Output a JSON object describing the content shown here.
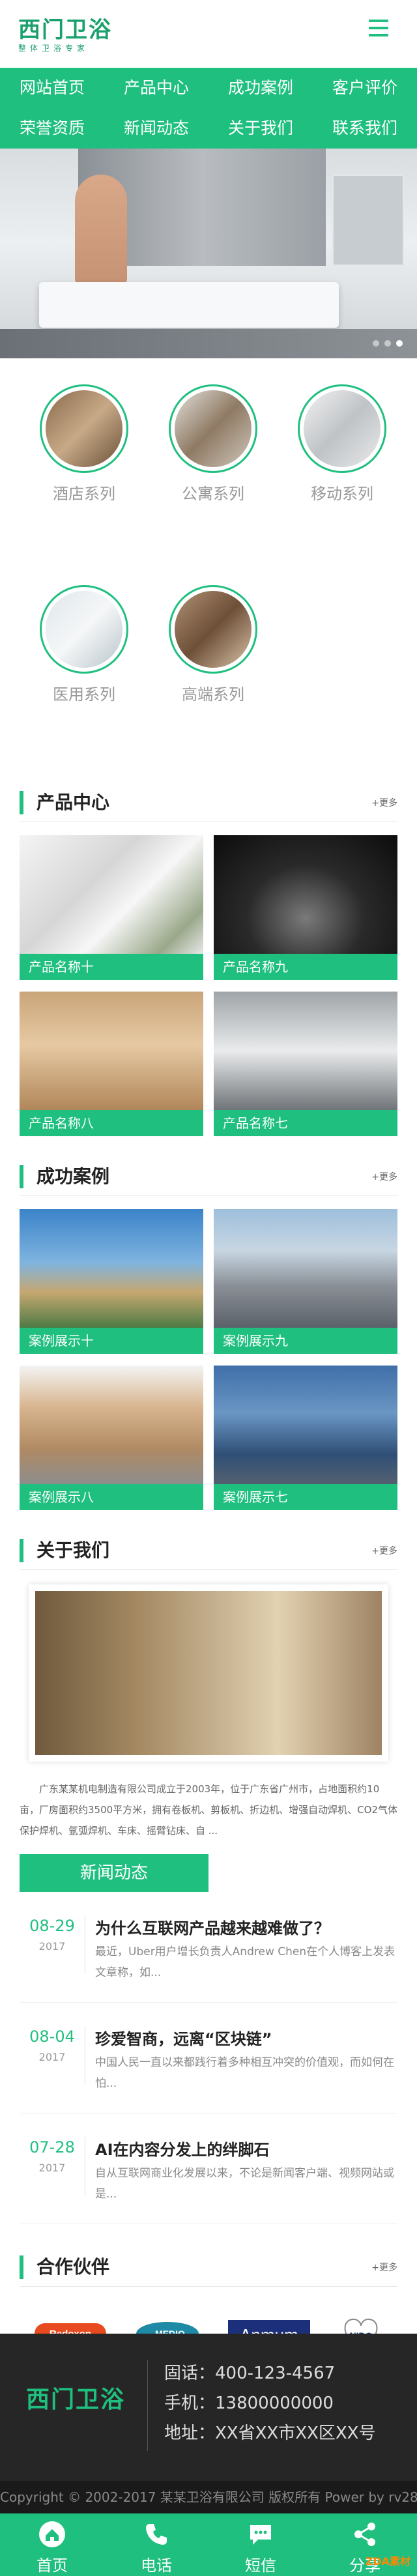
{
  "site": {
    "logo": "西门卫浴",
    "logo_sub": "整体卫浴专家"
  },
  "nav": [
    "网站首页",
    "产品中心",
    "成功案例",
    "客户评价",
    "荣誉资质",
    "新闻动态",
    "关于我们",
    "联系我们"
  ],
  "banner": {
    "slide_count": 3,
    "active_slide": 3
  },
  "categories": [
    "酒店系列",
    "公寓系列",
    "移动系列",
    "医用系列",
    "高端系列"
  ],
  "products": {
    "title": "产品中心",
    "more": "+更多",
    "items": [
      "产品名称十",
      "产品名称九",
      "产品名称八",
      "产品名称七"
    ]
  },
  "cases": {
    "title": "成功案例",
    "more": "+更多",
    "items": [
      "案例展示十",
      "案例展示九",
      "案例展示八",
      "案例展示七"
    ]
  },
  "about": {
    "title": "关于我们",
    "more": "+更多",
    "text": "广东某某机电制造有限公司成立于2003年，位于广东省广州市，占地面积约10亩，厂房面积约3500平方米，拥有卷板机、剪板机、折边机、增强自动焊机、CO2气体保护焊机、氩弧焊机、车床、摇臂钻床、自 ..."
  },
  "news": {
    "tab": "新闻动态",
    "items": [
      {
        "md": "08-29",
        "year": "2017",
        "title": "为什么互联网产品越来越难做了？",
        "desc": "最近，Uber用户增长负责人Andrew Chen在个人博客上发表文章称，如..."
      },
      {
        "md": "08-04",
        "year": "2017",
        "title": "珍爱智商，远离“区块链”",
        "desc": "中国人民一直以来都践行着多种相互冲突的价值观，而如何在怕..."
      },
      {
        "md": "07-28",
        "year": "2017",
        "title": "AI在内容分发上的绊脚石",
        "desc": "自从互联网商业化发展以来，不论是新闻客户端、视频网站或是..."
      }
    ]
  },
  "partners": {
    "title": "合作伙伴",
    "more": "+更多",
    "items": [
      "Redoxon",
      "MEDIQ",
      "Anmum",
      "NIDO"
    ]
  },
  "footer": {
    "logo": "西门卫浴",
    "phone": "固话：400-123-4567",
    "mobile": "手机：13800000000",
    "address": "地址：XX省XX市XX区XX号",
    "copyright": "Copyright © 2002-2017 某某卫浴有限公司 版权所有 Power by rv28"
  },
  "bottom_bar": [
    "首页",
    "电话",
    "短信",
    "分享"
  ],
  "watermark": "ZDA素材"
}
